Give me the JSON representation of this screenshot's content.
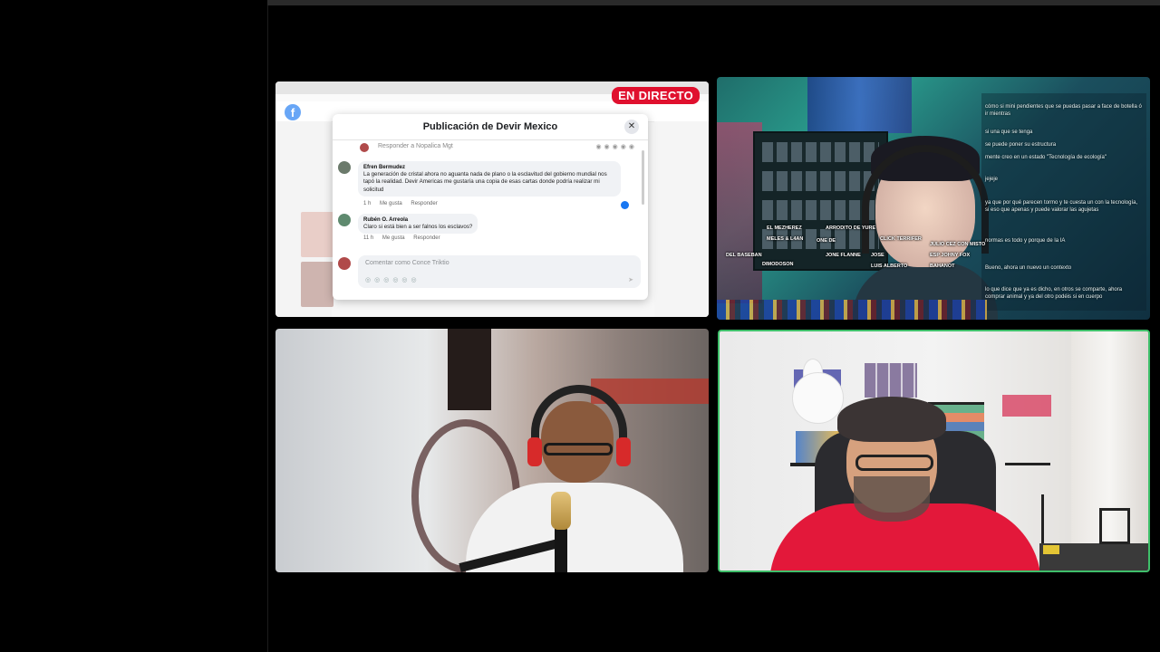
{
  "screen_share": {
    "live_badge": "EN DIRECTO",
    "logo_letter": "f",
    "modal": {
      "title": "Publicación de Devir Mexico",
      "close": "✕",
      "reply_to": "Responder a Nopalica Mgt",
      "comment1": {
        "author": "Efren Bermudez",
        "text": "La generación de cristal ahora no aguanta nada de plano o la esclavitud del gobierno mundial nos tapó la realidad. Devir Americas me gustaría una copia de esas cartas donde podría realizar mi solicitud",
        "time": "1 h",
        "like": "Me gusta",
        "reply": "Responder"
      },
      "comment2": {
        "author": "Rubén O. Arreola",
        "text": "Claro si está bien a ser falnos los esclavos?",
        "time": "11 h",
        "like": "Me gusta",
        "reply": "Responder"
      },
      "write_placeholder": "Comentar como Conce Triktio"
    }
  },
  "streamer": {
    "chat": [
      {
        "name": "",
        "text": "cómo si mini pendientes que se puedas pasar a face de botella ó ir mientras"
      },
      {
        "name": "",
        "text": "si una que se tenga"
      },
      {
        "name": "",
        "text": "se puede poner su estructura"
      },
      {
        "name": "",
        "text": "mente creo en un estado \"Tecnología de ecología\""
      },
      {
        "name": "",
        "text": "jejeje"
      },
      {
        "name": "",
        "text": "ya que por qué parecen tormo y te cuesta un con la tecnología, si eso que apenas y puede valorar las agujetas"
      },
      {
        "name": "",
        "text": "normas es todo y porque de la IA"
      },
      {
        "name": "",
        "text": "Bueno, ahora un nuevo un contexto"
      },
      {
        "name": "",
        "text": "lo que dice que ya es dicho, en otros se comparte, ahora comprar animal y ya del otro podéis si en cuerpo"
      }
    ],
    "viewer_names": [
      "EL MEZHEREZ",
      "ARRODITO DE YURE",
      "CLICK TERRIFER",
      "MELES & L4AN",
      "ONE DE",
      "JULIO CEZ CON MISTO",
      "DEL BASEBAN",
      "DIMODOSON",
      "JONE FLANNE",
      "JOSE",
      "LUIS ALBERTO",
      "ESP JOHNY FOX",
      "BAHANOT"
    ]
  },
  "colors": {
    "live_red": "#e0102e",
    "active_speaker_border": "#3fbf6a",
    "facebook_blue": "#1877f2"
  }
}
